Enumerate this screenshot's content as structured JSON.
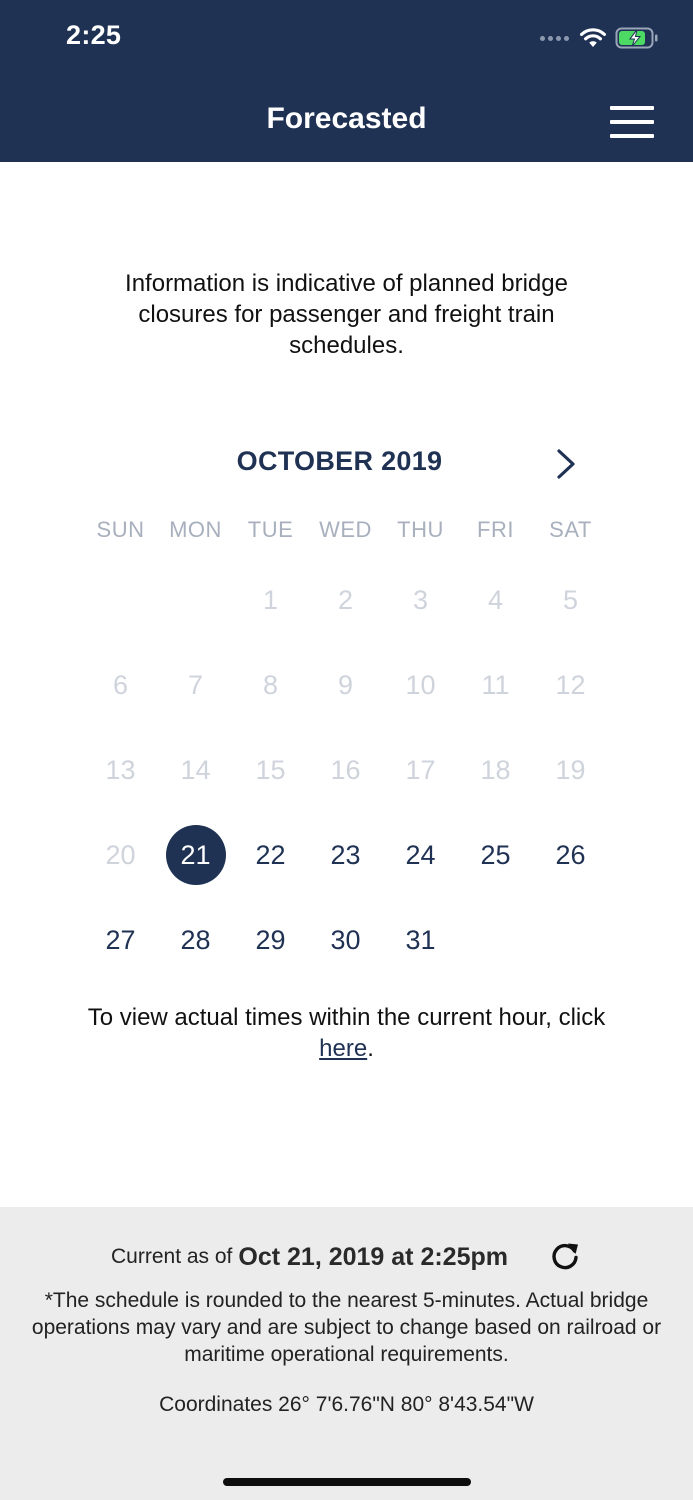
{
  "status_bar": {
    "time": "2:25"
  },
  "header": {
    "title": "Forecasted",
    "menu_icon": "hamburger-menu-icon"
  },
  "intro": "Information is indicative of planned bridge closures for passenger and freight train schedules.",
  "calendar": {
    "month_label": "OCTOBER 2019",
    "next_icon": "chevron-right-icon",
    "weekdays": [
      "SUN",
      "MON",
      "TUE",
      "WED",
      "THU",
      "FRI",
      "SAT"
    ],
    "selected_day": "21",
    "weeks": [
      [
        {
          "label": "",
          "state": "empty"
        },
        {
          "label": "",
          "state": "empty"
        },
        {
          "label": "1",
          "state": "past"
        },
        {
          "label": "2",
          "state": "past"
        },
        {
          "label": "3",
          "state": "past"
        },
        {
          "label": "4",
          "state": "past"
        },
        {
          "label": "5",
          "state": "past"
        }
      ],
      [
        {
          "label": "6",
          "state": "past"
        },
        {
          "label": "7",
          "state": "past"
        },
        {
          "label": "8",
          "state": "past"
        },
        {
          "label": "9",
          "state": "past"
        },
        {
          "label": "10",
          "state": "past"
        },
        {
          "label": "11",
          "state": "past"
        },
        {
          "label": "12",
          "state": "past"
        }
      ],
      [
        {
          "label": "13",
          "state": "past"
        },
        {
          "label": "14",
          "state": "past"
        },
        {
          "label": "15",
          "state": "past"
        },
        {
          "label": "16",
          "state": "past"
        },
        {
          "label": "17",
          "state": "past"
        },
        {
          "label": "18",
          "state": "past"
        },
        {
          "label": "19",
          "state": "past"
        }
      ],
      [
        {
          "label": "20",
          "state": "past"
        },
        {
          "label": "21",
          "state": "selected"
        },
        {
          "label": "22",
          "state": "available"
        },
        {
          "label": "23",
          "state": "available"
        },
        {
          "label": "24",
          "state": "available"
        },
        {
          "label": "25",
          "state": "available"
        },
        {
          "label": "26",
          "state": "available"
        }
      ],
      [
        {
          "label": "27",
          "state": "available"
        },
        {
          "label": "28",
          "state": "available"
        },
        {
          "label": "29",
          "state": "available"
        },
        {
          "label": "30",
          "state": "available"
        },
        {
          "label": "31",
          "state": "available"
        },
        {
          "label": "",
          "state": "empty"
        },
        {
          "label": "",
          "state": "empty"
        }
      ]
    ]
  },
  "hour_note": {
    "before": "To view actual times within the current hour, click ",
    "link": "here",
    "after": "."
  },
  "footer": {
    "updated_prefix": "Current as of",
    "updated_value": "Oct 21, 2019 at 2:25pm",
    "refresh_icon": "refresh-icon",
    "disclaimer": "*The schedule is rounded to the nearest 5-minutes. Actual bridge operations may vary and are subject to change based on railroad or maritime operational requirements.",
    "coordinates": "Coordinates 26° 7'6.76\"N 80° 8'43.54\"W"
  },
  "colors": {
    "brand_navy": "#1f3253",
    "past_day": "#cfd4dc",
    "weekday_label": "#a8b0be",
    "footer_bg": "#ececec",
    "battery_green": "#4cd964"
  }
}
